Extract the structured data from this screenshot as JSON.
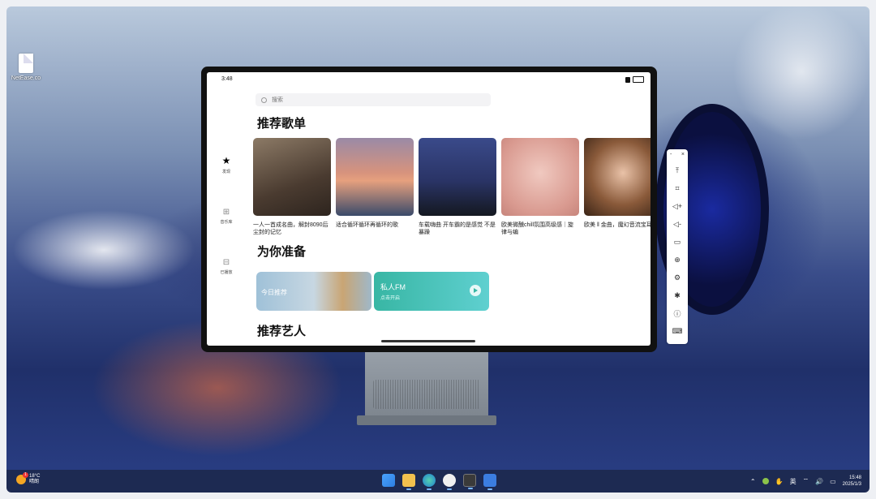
{
  "desktop": {
    "file_name": "NetEase.co"
  },
  "phone": {
    "status_time": "3:48",
    "search_placeholder": "搜索",
    "nav": [
      {
        "label": "发现",
        "icon": "star-icon"
      },
      {
        "label": "音乐库",
        "icon": "grid-icon"
      },
      {
        "label": "已播放",
        "icon": "library-icon"
      }
    ],
    "sections": {
      "recommended_playlists": "推荐歌单",
      "for_you": "为你准备",
      "recommended_artists": "推荐艺人"
    },
    "playlists": [
      {
        "title": "一人一首成名曲，解封8090后尘封的记忆",
        "color": "#6b5a4a"
      },
      {
        "title": "适合循环循环再循环的歌",
        "color": "#b06a5a"
      },
      {
        "title": "车载嗨曲 开车霸的是感觉 不是暴躁",
        "color": "#2a3a66"
      },
      {
        "title": "欧美微醺chill氛围高级感｜旋律与编",
        "color": "#e4b6ae"
      },
      {
        "title": "欧美 ‖ 金曲，魔幻音流宝耳畔",
        "color": "#7a4a2a"
      }
    ],
    "for_you_cards": {
      "daily": "今日推荐",
      "fm_title": "私人FM",
      "fm_sub": "点击开启"
    }
  },
  "toolbar": {
    "minimize": "-",
    "close": "×",
    "buttons": [
      {
        "name": "pin-top-icon",
        "glyph": "⤒"
      },
      {
        "name": "crop-icon",
        "glyph": "⌗"
      },
      {
        "name": "volume-up-icon",
        "glyph": "◁+"
      },
      {
        "name": "volume-down-icon",
        "glyph": "◁-"
      },
      {
        "name": "rotate-icon",
        "glyph": "▭"
      },
      {
        "name": "globe-icon",
        "glyph": "⊕"
      },
      {
        "name": "settings-icon",
        "glyph": "⚙"
      },
      {
        "name": "bug-icon",
        "glyph": "✱"
      },
      {
        "name": "info-icon",
        "glyph": "ⓘ"
      },
      {
        "name": "keyboard-icon",
        "glyph": "⌨"
      }
    ]
  },
  "taskbar": {
    "weather_temp": "18°C",
    "weather_desc": "晴朗",
    "ime": "英",
    "time": "15:48",
    "date": "2025/1/3",
    "apps": [
      {
        "name": "windows-start-icon",
        "color": "#4aa3ff"
      },
      {
        "name": "file-explorer-icon",
        "color": "#f2c14e"
      },
      {
        "name": "edge-browser-icon",
        "color": "#2fb7a5"
      },
      {
        "name": "qq-icon",
        "color": "#f0f0f0"
      },
      {
        "name": "terminal-icon",
        "color": "#3a3a3a"
      },
      {
        "name": "emulator-icon",
        "color": "#3b7de0"
      }
    ]
  }
}
